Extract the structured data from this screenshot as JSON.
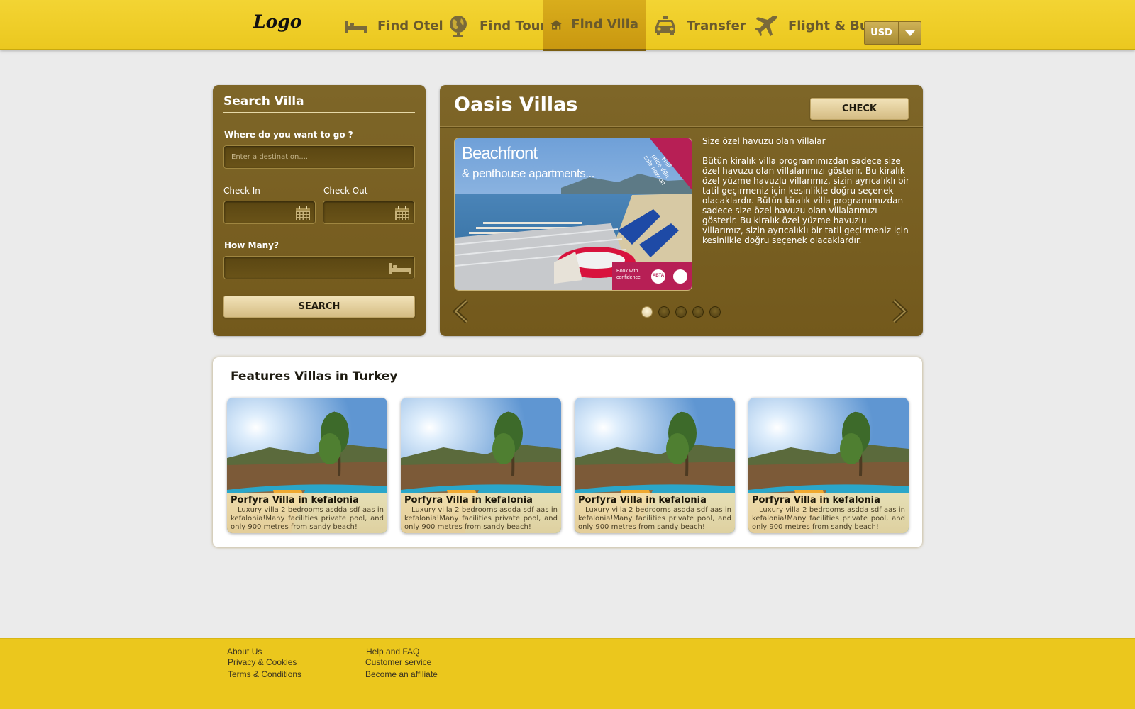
{
  "header": {
    "logo": "Logo",
    "nav": [
      {
        "label": "Find Otel",
        "icon": "bed-icon"
      },
      {
        "label": "Find Tour",
        "icon": "globe-icon"
      },
      {
        "label": "Find Villa",
        "icon": "house-icon",
        "active": true
      },
      {
        "label": "Transfer",
        "icon": "taxi-icon"
      },
      {
        "label": "Flight & Bus",
        "icon": "airplane-icon"
      }
    ],
    "currency": "USD"
  },
  "search": {
    "title": "Search Villa",
    "destination_label": "Where do you want to go ?",
    "destination_placeholder": "Enter a destination....",
    "checkin_label": "Check In",
    "checkout_label": "Check Out",
    "guests_label": "How Many?",
    "button": "SEARCH"
  },
  "offer": {
    "title": "Oasis Villas",
    "check_button": "CHECK",
    "image_text": {
      "headline": "Beachfront",
      "subheadline": "& penthouse apartments...",
      "banner": [
        "Half",
        "price villa",
        "sale now on"
      ],
      "badge_left": "Book with confidence",
      "badge_right": "ABTA"
    },
    "subtitle": "Size özel havuzu olan villalar",
    "description": "Bütün kiralık villa programımızdan sadece size özel havuzu olan villalarımızı gösterir. Bu kiralık özel yüzme havuzlu villarımız, sizin ayrıcalıklı bir tatil geçirmeniz için kesinlikle doğru seçenek olacaklardır. Bütün kiralık villa programımızdan sadece size özel havuzu olan villalarımızı gösterir. Bu kiralık özel yüzme havuzlu villarımız, sizin ayrıcalıklı bir tatil geçirmeniz için kesinlikle doğru seçenek olacaklardır.",
    "dots": [
      true,
      false,
      false,
      false,
      false
    ]
  },
  "featured": {
    "title": "Features Villas in Turkey",
    "cards": [
      {
        "title": "Porfyra Villa in kefalonia",
        "desc": "Luxury villa 2 bedrooms asdda sdf aas in kefalonia!Many facilities private pool, and only 900 metres from sandy beach!"
      },
      {
        "title": "Porfyra Villa in kefalonia",
        "desc": "Luxury villa 2 bedrooms asdda sdf aas in kefalonia!Many facilities private pool, and only 900 metres from sandy beach!"
      },
      {
        "title": "Porfyra Villa in kefalonia",
        "desc": "Luxury villa 2 bedrooms asdda sdf aas in kefalonia!Many facilities private pool, and only 900 metres from sandy beach!"
      },
      {
        "title": "Porfyra Villa in kefalonia",
        "desc": "Luxury villa 2 bedrooms asdda sdf aas in kefalonia!Many facilities private pool, and only 900 metres from sandy beach!"
      }
    ]
  },
  "footer": {
    "col1": [
      "About Us",
      "Privacy & Cookies",
      "Terms & Conditions"
    ],
    "col2": [
      "Help and FAQ",
      "Customer service",
      "Become an affiliate"
    ]
  },
  "colors": {
    "header": "#ebc81f",
    "panel": "#7b6226",
    "accent_text": "#6a5a2c",
    "footer": "#ebc71d"
  }
}
